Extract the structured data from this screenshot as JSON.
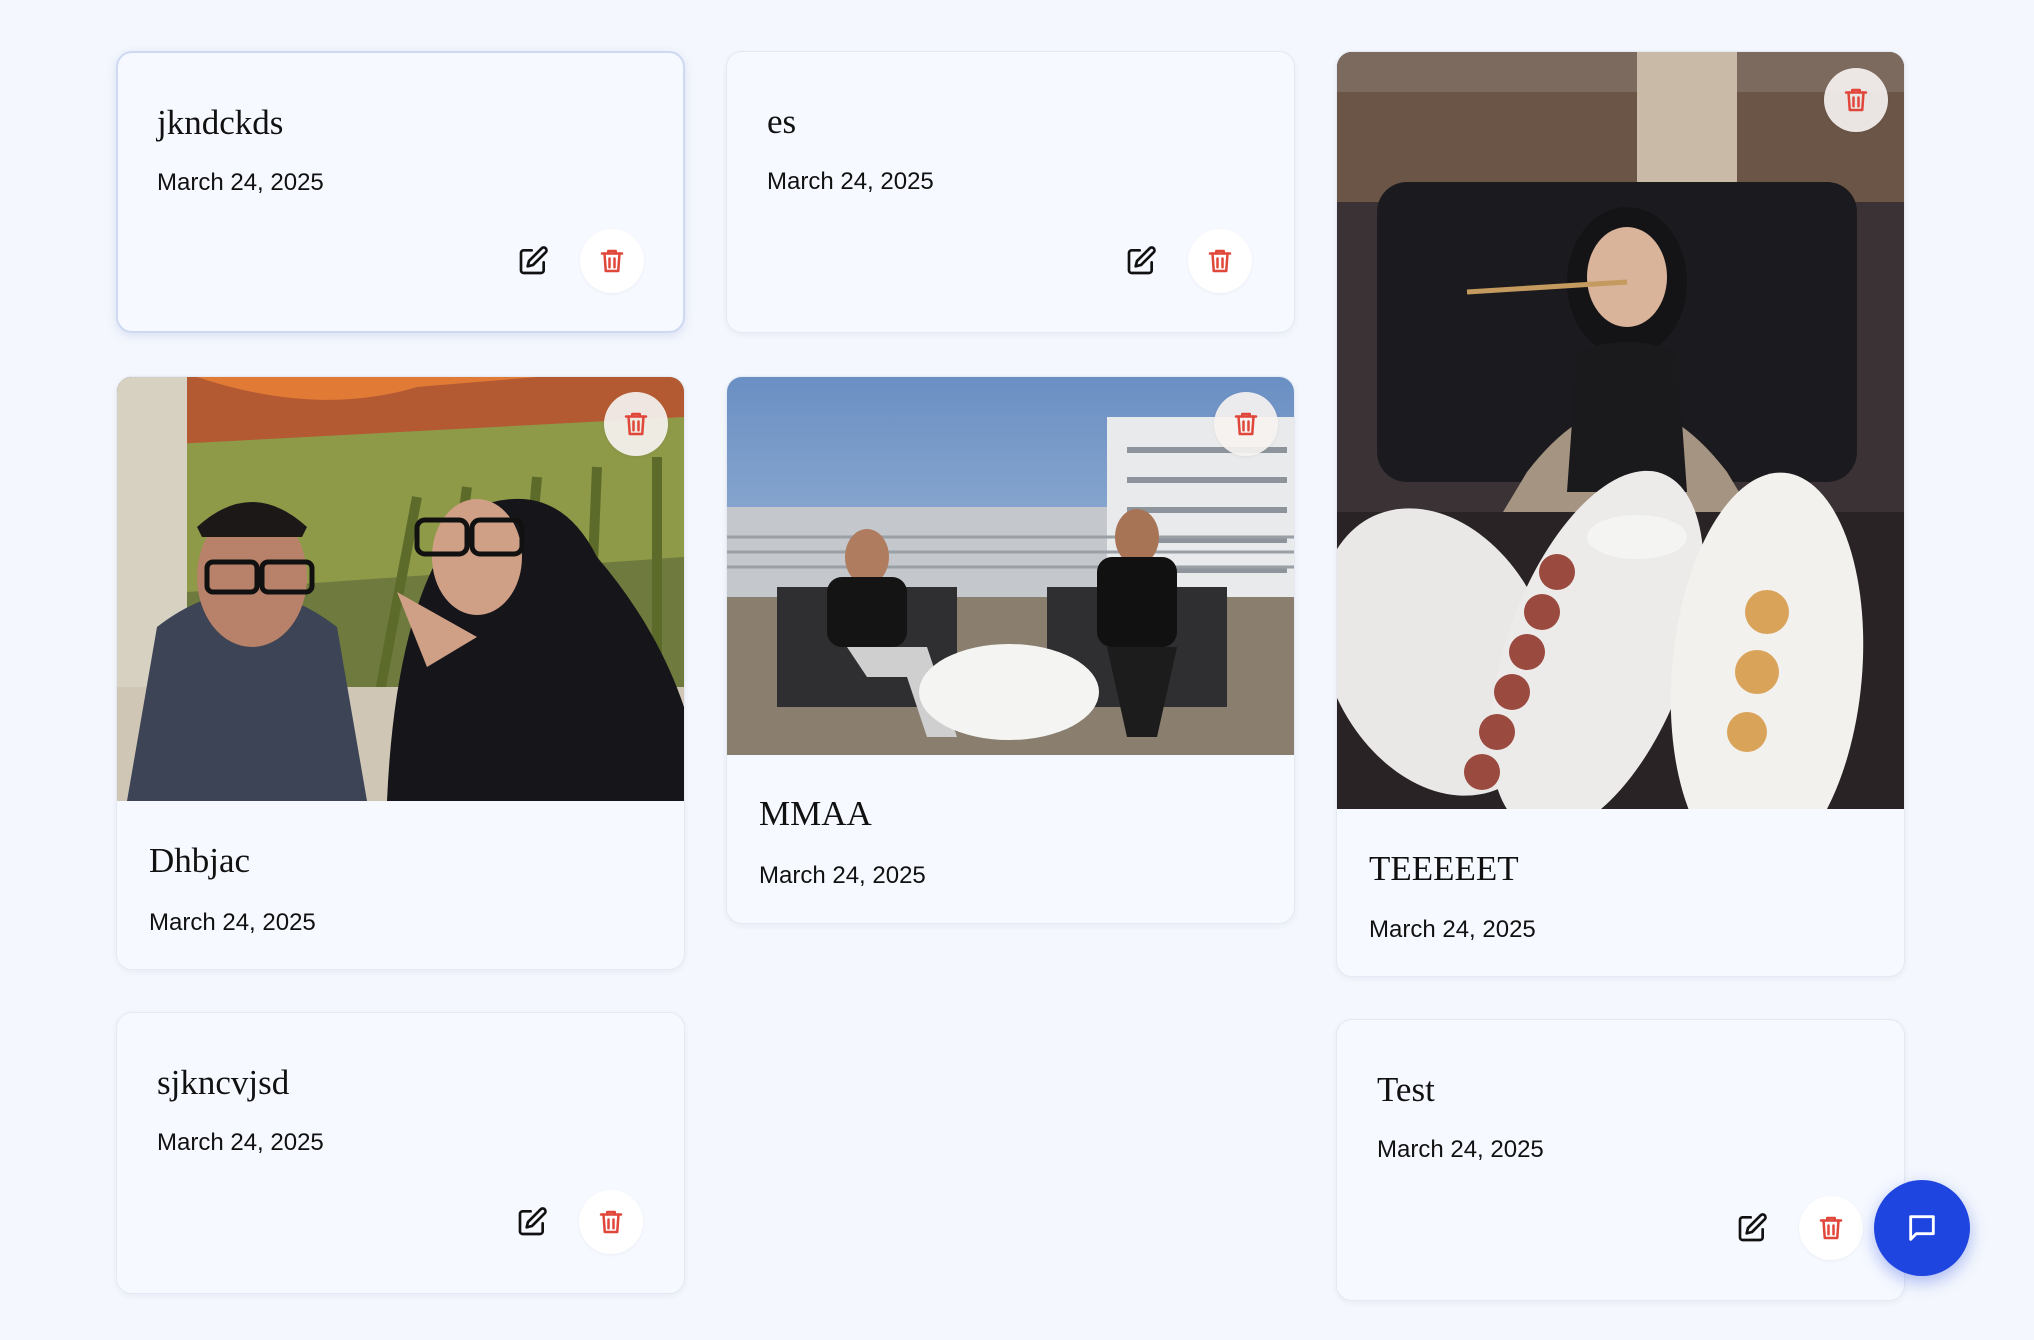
{
  "colors": {
    "page_bg": "#f4f7fd",
    "card_bg": "#f6f9ff",
    "delete_red": "#e0463a",
    "fab_blue": "#1f45e0"
  },
  "notes": [
    {
      "title": "jkndckds",
      "date": "March 24, 2025",
      "has_image": false,
      "selected": true,
      "edit_icon": "edit-icon",
      "delete_icon": "trash-icon"
    },
    {
      "title": "es",
      "date": "March 24, 2025",
      "has_image": false,
      "edit_icon": "edit-icon",
      "delete_icon": "trash-icon"
    },
    {
      "title": "TEEEEET",
      "date": "March 24, 2025",
      "has_image": true,
      "image_alt": "Woman in hijab holding chopsticks over sushi plates at a restaurant",
      "delete_icon": "trash-icon"
    },
    {
      "title": "Dhbjac",
      "date": "March 24, 2025",
      "has_image": true,
      "image_alt": "Selfie of a man and a woman in glasses in front of a painting",
      "delete_icon": "trash-icon"
    },
    {
      "title": "MMAA",
      "date": "March 24, 2025",
      "has_image": true,
      "image_alt": "Two men sitting on a sunny rooftop balcony",
      "delete_icon": "trash-icon"
    },
    {
      "title": "sjkncvjsd",
      "date": "March 24, 2025",
      "has_image": false,
      "edit_icon": "edit-icon",
      "delete_icon": "trash-icon"
    },
    {
      "title": "Test",
      "date": "March 24, 2025",
      "has_image": false,
      "edit_icon": "edit-icon",
      "delete_icon": "trash-icon"
    }
  ],
  "chat_button": {
    "icon": "chat-bubble-icon"
  }
}
